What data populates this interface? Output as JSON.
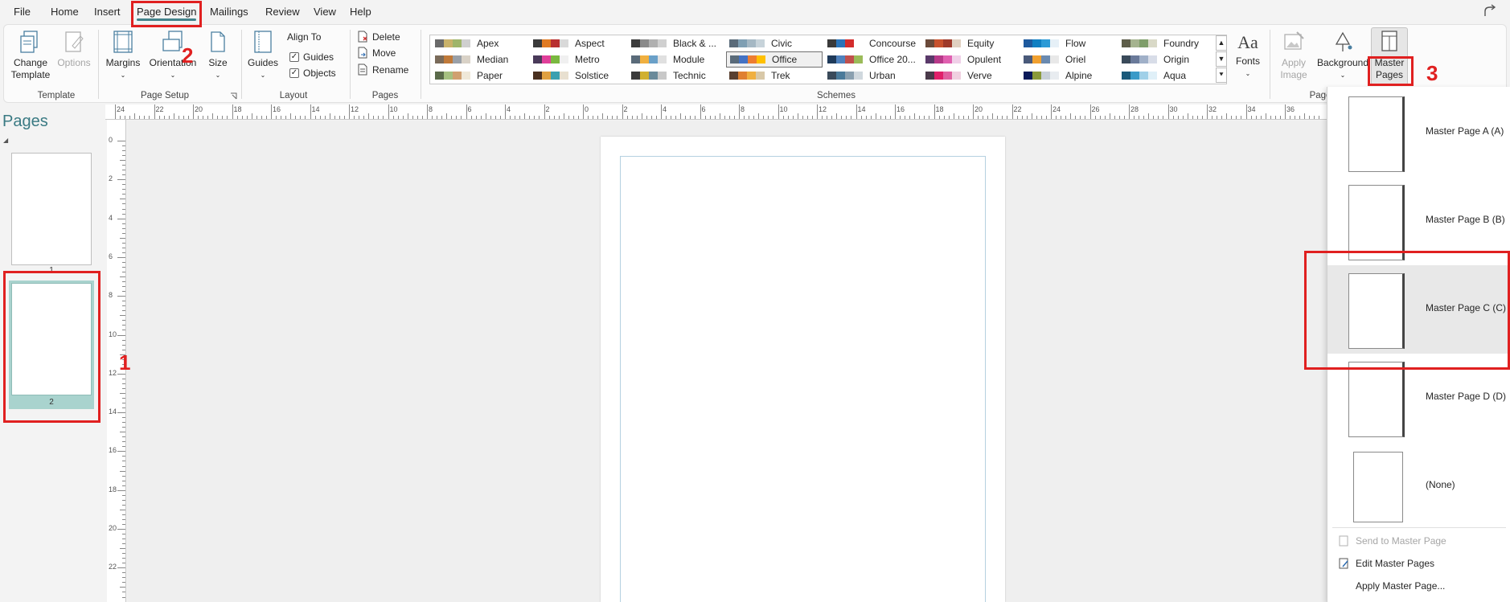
{
  "menu": {
    "tabs": [
      "File",
      "Home",
      "Insert",
      "Page Design",
      "Mailings",
      "Review",
      "View",
      "Help"
    ],
    "active": "Page Design"
  },
  "ribbon": {
    "template": {
      "change_template": "Change Template",
      "options": "Options",
      "group": "Template"
    },
    "page_setup": {
      "margins": "Margins",
      "orientation": "Orientation",
      "size": "Size",
      "group": "Page Setup"
    },
    "layout": {
      "guides": "Guides",
      "align_to": "Align To",
      "guides_check": "Guides",
      "objects_check": "Objects",
      "group": "Layout"
    },
    "pages": {
      "delete": "Delete",
      "move": "Move",
      "rename": "Rename",
      "group": "Pages"
    },
    "schemes": {
      "group": "Schemes",
      "items": [
        {
          "name": "Apex",
          "colors": [
            "#6a6a6a",
            "#c9b26a",
            "#9fb56a",
            "#cfcfcf"
          ]
        },
        {
          "name": "Aspect",
          "colors": [
            "#3b3b3b",
            "#e07a22",
            "#b83030",
            "#d9d9d9"
          ]
        },
        {
          "name": "Black & ...",
          "colors": [
            "#3c3c3c",
            "#8a8a8a",
            "#b0b0b0",
            "#d0d0d0"
          ]
        },
        {
          "name": "Civic",
          "colors": [
            "#5a6b7a",
            "#7f9fb3",
            "#a5b8c4",
            "#c7d3da"
          ]
        },
        {
          "name": "Concourse",
          "colors": [
            "#3a3a3a",
            "#2a73b8",
            "#d32c2c",
            "#ffffff"
          ]
        },
        {
          "name": "Equity",
          "colors": [
            "#6b4a3a",
            "#c8522e",
            "#9e3a2a",
            "#e0d0c0"
          ]
        },
        {
          "name": "Flow",
          "colors": [
            "#1e5a9e",
            "#0f7fc2",
            "#2b9ad6",
            "#e6f0f7"
          ]
        },
        {
          "name": "Foundry",
          "colors": [
            "#5e5e4a",
            "#a5b38f",
            "#7f9e6a",
            "#d9d9c7"
          ]
        },
        {
          "name": "Median",
          "colors": [
            "#7a6b5a",
            "#c07a3a",
            "#9aa0a8",
            "#d9d2c7"
          ]
        },
        {
          "name": "Metro",
          "colors": [
            "#4a3a5a",
            "#e0409a",
            "#7ab840",
            "#f0f0f0"
          ]
        },
        {
          "name": "Module",
          "colors": [
            "#5a6b7a",
            "#f0b040",
            "#6aa0c8",
            "#e0e0e0"
          ]
        },
        {
          "name": "Office",
          "colors": [
            "#5a6b7a",
            "#4472c4",
            "#ed7d31",
            "#ffc000"
          ]
        },
        {
          "name": "Office 20...",
          "colors": [
            "#1f3a5a",
            "#4f81bd",
            "#c0504d",
            "#9bbb59"
          ]
        },
        {
          "name": "Opulent",
          "colors": [
            "#5a3a6a",
            "#b83a8a",
            "#e060b0",
            "#f0d0e8"
          ]
        },
        {
          "name": "Oriel",
          "colors": [
            "#4a5a7a",
            "#f0a030",
            "#6a8ab0",
            "#e8e8e8"
          ]
        },
        {
          "name": "Origin",
          "colors": [
            "#3a4a5a",
            "#6a7a9a",
            "#a0b0c8",
            "#d8dde8"
          ]
        },
        {
          "name": "Paper",
          "colors": [
            "#5a6a4a",
            "#a5c080",
            "#d0a070",
            "#efe8d8"
          ]
        },
        {
          "name": "Solstice",
          "colors": [
            "#4a3020",
            "#e0a040",
            "#3aa0b0",
            "#e8e0d0"
          ]
        },
        {
          "name": "Technic",
          "colors": [
            "#3a3a3a",
            "#d0b030",
            "#6a8a9a",
            "#c8c8c8"
          ]
        },
        {
          "name": "Trek",
          "colors": [
            "#5a4030",
            "#e08030",
            "#f0b040",
            "#d8c8a8"
          ]
        },
        {
          "name": "Urban",
          "colors": [
            "#3a4a5a",
            "#4a7a9a",
            "#8aa0b0",
            "#d0d8de"
          ]
        },
        {
          "name": "Verve",
          "colors": [
            "#4a3a4a",
            "#e0206a",
            "#e060a0",
            "#f0d0e0"
          ]
        },
        {
          "name": "Alpine",
          "colors": [
            "#0a1a5a",
            "#8a9a3a",
            "#c8d0d8",
            "#e8ecf0"
          ]
        },
        {
          "name": "Aqua",
          "colors": [
            "#1a5a7a",
            "#3a9ac8",
            "#a0d0e8",
            "#e0f0f8"
          ]
        }
      ],
      "selected": "Office"
    },
    "fonts": {
      "label": "Fonts",
      "glyph": "Aa"
    },
    "page_background": {
      "apply_image": "Apply Image",
      "background": "Background",
      "master_pages": "Master Pages",
      "group": "Page"
    }
  },
  "pages_pane": {
    "title": "Pages",
    "thumbnails": [
      {
        "number": "1"
      },
      {
        "number": "2"
      }
    ]
  },
  "rulers": {
    "horizontal": [
      "24",
      "22",
      "20",
      "18",
      "16",
      "14",
      "12",
      "10",
      "8",
      "6",
      "4",
      "2",
      "0",
      "2",
      "4",
      "6",
      "8",
      "10",
      "12",
      "14",
      "16",
      "18",
      "20",
      "22",
      "24",
      "26",
      "28",
      "30",
      "32",
      "34",
      "36"
    ],
    "vertical": [
      "0",
      "2",
      "4",
      "6",
      "8",
      "10",
      "12",
      "14",
      "16",
      "18",
      "20",
      "22"
    ]
  },
  "master_pages_menu": {
    "items": [
      {
        "label": "Master Page A (A)"
      },
      {
        "label": "Master Page B (B)"
      },
      {
        "label": "Master Page C (C)"
      },
      {
        "label": "Master Page D (D)"
      },
      {
        "label": "(None)"
      }
    ],
    "highlighted": "Master Page C (C)",
    "commands": {
      "send_to_master": "Send to Master Page",
      "edit_master": "Edit Master Pages",
      "apply_master": "Apply Master Page..."
    }
  },
  "annotations": {
    "step1": "1",
    "step2": "2",
    "step3": "3"
  }
}
